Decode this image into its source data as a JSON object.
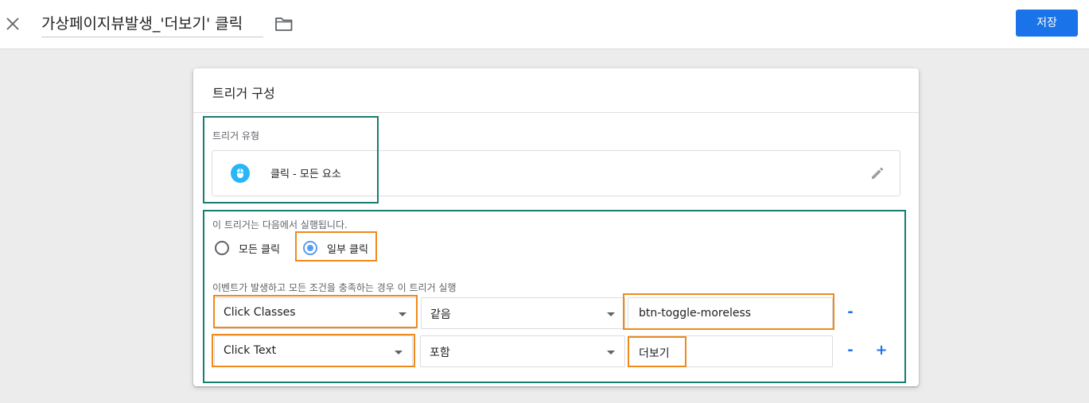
{
  "header": {
    "title": "가상페이지뷰발생_'더보기' 클릭",
    "save_label": "저장"
  },
  "card": {
    "title": "트리거 구성",
    "trigger_type_label": "트리거 유형",
    "trigger_type_value": "클릭 - 모든 요소",
    "fires_on_label": "이 트리거는 다음에서 실행됩니다.",
    "radio_all": "모든 클릭",
    "radio_some": "일부 클릭",
    "selected_option": "일부 클릭",
    "condition_label": "이벤트가 발생하고 모든 조건을 충족하는 경우 이 트리거 실행",
    "conditions": [
      {
        "variable": "Click Classes",
        "operator": "같음",
        "value": "btn-toggle-moreless"
      },
      {
        "variable": "Click Text",
        "operator": "포함",
        "value": "더보기"
      }
    ],
    "remove_label": "-",
    "add_label": "+"
  },
  "icons": {
    "close": "close-icon",
    "folder": "folder-icon",
    "trigger_type": "mouse-click-icon",
    "edit": "pencil-edit-icon",
    "dropdown": "dropdown-arrow-icon"
  },
  "colors": {
    "primary": "#1a73e8",
    "trigger_icon": "#29b6f6",
    "highlight_teal": "#177e6f",
    "highlight_orange": "#f08a1c",
    "radio_selected": "#5b9bf0"
  }
}
